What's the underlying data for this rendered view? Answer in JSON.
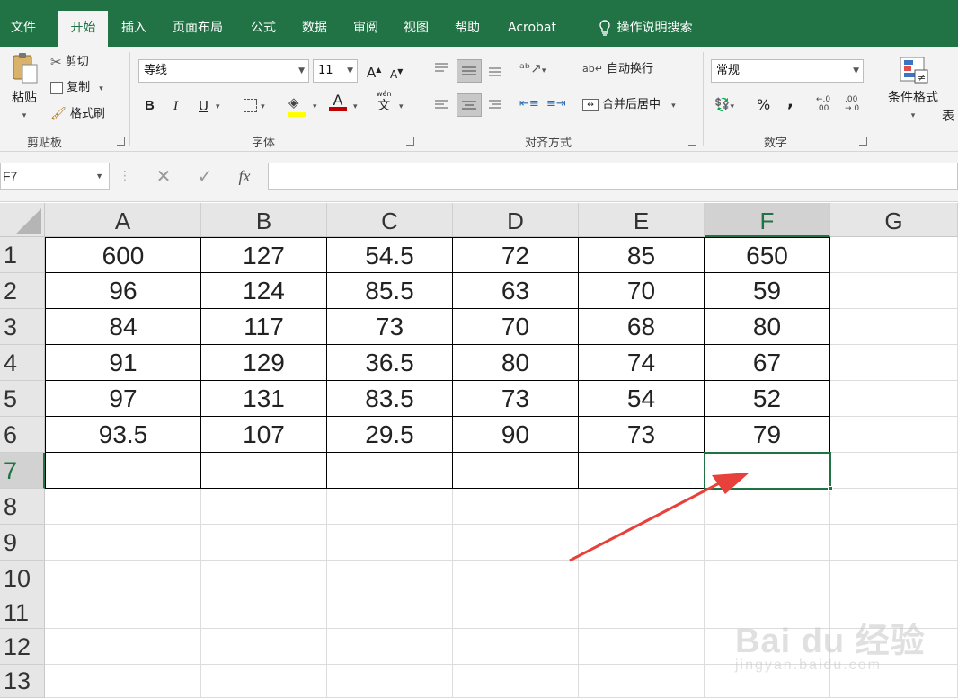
{
  "tabs": [
    "文件",
    "开始",
    "插入",
    "页面布局",
    "公式",
    "数据",
    "审阅",
    "视图",
    "帮助",
    "Acrobat",
    "操作说明搜索"
  ],
  "clipboard": {
    "paste": "粘贴",
    "cut": "剪切",
    "copy": "复制",
    "format_painter": "格式刷",
    "label": "剪贴板"
  },
  "font": {
    "name": "等线",
    "size": "11",
    "grow": "A",
    "shrink": "A",
    "bold": "B",
    "italic": "I",
    "underline": "U",
    "font_color_glyph": "A",
    "phonetic_top": "wén",
    "phonetic_bottom": "文",
    "label": "字体"
  },
  "alignment": {
    "wrap_text": "自动换行",
    "merge_center": "合并后居中",
    "label": "对齐方式"
  },
  "number": {
    "format": "常规",
    "percent": "%",
    "comma": ",",
    "label": "数字"
  },
  "styles": {
    "conditional": "条件格式",
    "table_partial": "表"
  },
  "formula_bar": {
    "name_box": "F7",
    "cancel": "✕",
    "enter": "✓",
    "fx": "fx",
    "value": ""
  },
  "columns": [
    "A",
    "B",
    "C",
    "D",
    "E",
    "F",
    "G"
  ],
  "selected_column": "F",
  "rows": [
    "1",
    "2",
    "3",
    "4",
    "5",
    "6",
    "7",
    "8",
    "9",
    "10",
    "11",
    "12",
    "13"
  ],
  "selected_row": "7",
  "selected_cell": "F7",
  "cells": [
    [
      "600",
      "127",
      "54.5",
      "72",
      "85",
      "650"
    ],
    [
      "96",
      "124",
      "85.5",
      "63",
      "70",
      "59"
    ],
    [
      "84",
      "117",
      "73",
      "70",
      "68",
      "80"
    ],
    [
      "91",
      "129",
      "36.5",
      "80",
      "74",
      "67"
    ],
    [
      "97",
      "131",
      "83.5",
      "73",
      "54",
      "52"
    ],
    [
      "93.5",
      "107",
      "29.5",
      "90",
      "73",
      "79"
    ],
    [
      "",
      "",
      "",
      "",
      "",
      ""
    ]
  ],
  "colors": {
    "excel_green": "#217346",
    "arrow": "#e8403a",
    "font_color_bar": "#c00000",
    "highlight_bar": "#ffff00"
  },
  "watermark": {
    "main": "Bai du 经验",
    "sub": "jingyan.baidu.com"
  }
}
